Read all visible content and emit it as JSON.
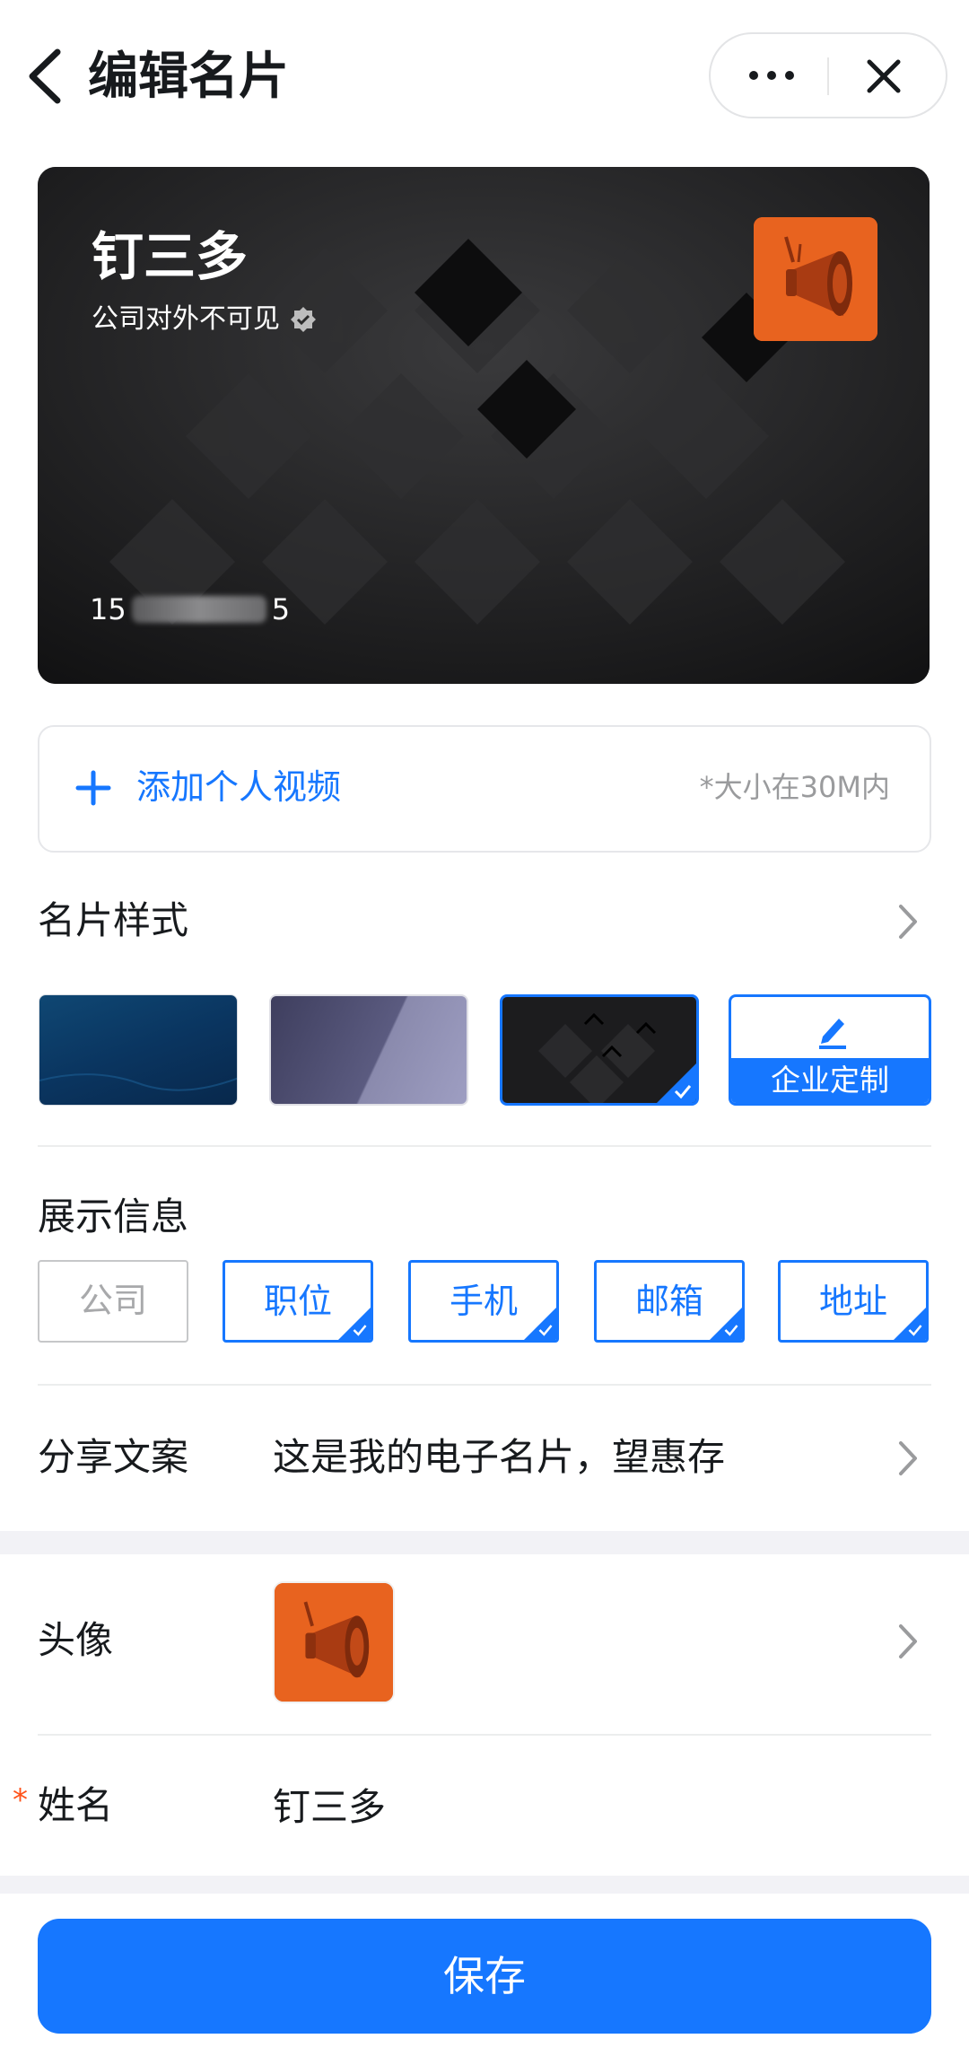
{
  "header": {
    "title": "编辑名片"
  },
  "card": {
    "name": "钉三多",
    "subtitle": "公司对外不可见",
    "phone_prefix": "15",
    "phone_suffix": "5"
  },
  "video": {
    "label": "添加个人视频",
    "hint": "*大小在30M内"
  },
  "styles": {
    "label": "名片样式",
    "custom_label": "企业定制"
  },
  "display_info": {
    "label": "展示信息",
    "tags": [
      {
        "label": "公司",
        "checked": false
      },
      {
        "label": "职位",
        "checked": true
      },
      {
        "label": "手机",
        "checked": true
      },
      {
        "label": "邮箱",
        "checked": true
      },
      {
        "label": "地址",
        "checked": true
      }
    ]
  },
  "share": {
    "label": "分享文案",
    "value": "这是我的电子名片，望惠存"
  },
  "avatar": {
    "label": "头像"
  },
  "name_field": {
    "required_mark": "*",
    "label": "姓名",
    "value": "钉三多"
  },
  "footer": {
    "save_label": "保存"
  },
  "colors": {
    "accent": "#1677ff",
    "logo_bg": "#e8631f",
    "required": "#ff5219"
  }
}
